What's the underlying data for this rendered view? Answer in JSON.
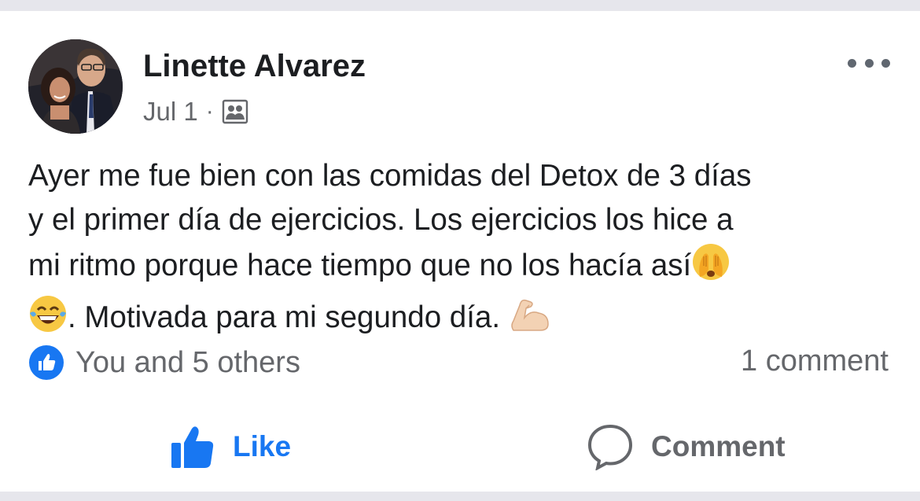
{
  "post": {
    "author": "Linette Alvarez",
    "date": "Jul 1",
    "separator": "·",
    "audience_icon": "friends-group-icon",
    "more_icon": "more-options-icon",
    "text_lines": [
      "Ayer me fue bien con las comidas del Detox de 3 días",
      "y el primer día de ejercicios. Los ejercicios los hice a",
      "mi ritmo porque hace tiempo que no los hacía así",
      ". Motivada para mi segundo día."
    ],
    "emojis": [
      "face-covering-eyes-emoji",
      "laughing-tears-emoji",
      "flexed-biceps-emoji"
    ]
  },
  "reactions": {
    "icon": "like-reaction-icon",
    "summary": "You and 5 others"
  },
  "comments": {
    "count_label": "1 comment"
  },
  "actions": {
    "like_label": "Like",
    "comment_label": "Comment"
  },
  "colors": {
    "accent": "#1877f2",
    "secondary_text": "#65676b",
    "primary_text": "#1c1e21",
    "divider_band": "#e6e6ec"
  }
}
